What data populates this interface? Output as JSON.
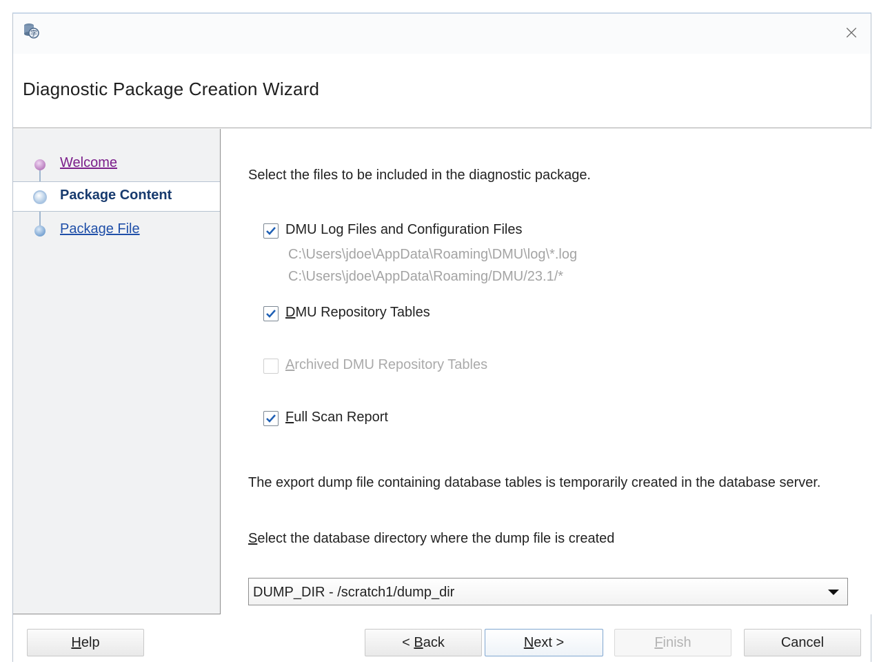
{
  "wizard": {
    "title": "Diagnostic Package Creation Wizard",
    "close_label": "×"
  },
  "nav": {
    "items": [
      {
        "label": "Welcome",
        "state": "visited"
      },
      {
        "label": "Package Content",
        "state": "current"
      },
      {
        "label": "Package File",
        "state": "pending"
      }
    ]
  },
  "content": {
    "intro": "Select the files to be included in the diagnostic package.",
    "options": [
      {
        "label": "DMU Log Files and Configuration Files",
        "checked": true,
        "enabled": true,
        "paths": [
          "C:\\Users\\jdoe\\AppData\\Roaming\\DMU\\log\\*.log",
          "C:\\Users\\jdoe\\AppData\\Roaming/DMU/23.1/*"
        ]
      },
      {
        "mnemonic": "D",
        "label_rest": "MU Repository Tables",
        "checked": true,
        "enabled": true
      },
      {
        "mnemonic": "A",
        "label_rest": "rchived DMU Repository Tables",
        "checked": false,
        "enabled": false
      },
      {
        "mnemonic": "F",
        "label_rest": "ull Scan Report",
        "checked": true,
        "enabled": true
      }
    ],
    "dump_note": "The export dump file containing database tables is temporarily created in the database server.",
    "select_dir_mnemonic": "S",
    "select_dir_rest": "elect the database directory where the dump file is created",
    "directory_selected": "DUMP_DIR - /scratch1/dump_dir"
  },
  "buttons": {
    "help": {
      "mnemonic": "H",
      "rest": "elp"
    },
    "back": {
      "prefix": "< ",
      "mnemonic": "B",
      "rest": "ack"
    },
    "next": {
      "mnemonic": "N",
      "rest": "ext >"
    },
    "finish": {
      "mnemonic": "F",
      "rest": "inish"
    },
    "cancel": "Cancel"
  },
  "colors": {
    "check": "#1e5fb4",
    "visited_link": "#7b1e8a",
    "link": "#1f4fa8",
    "current": "#173a6e"
  },
  "icons": {
    "app": "database-translate-icon",
    "close": "close-icon",
    "check": "checkmark-icon",
    "dropdown": "dropdown-arrow-icon"
  }
}
